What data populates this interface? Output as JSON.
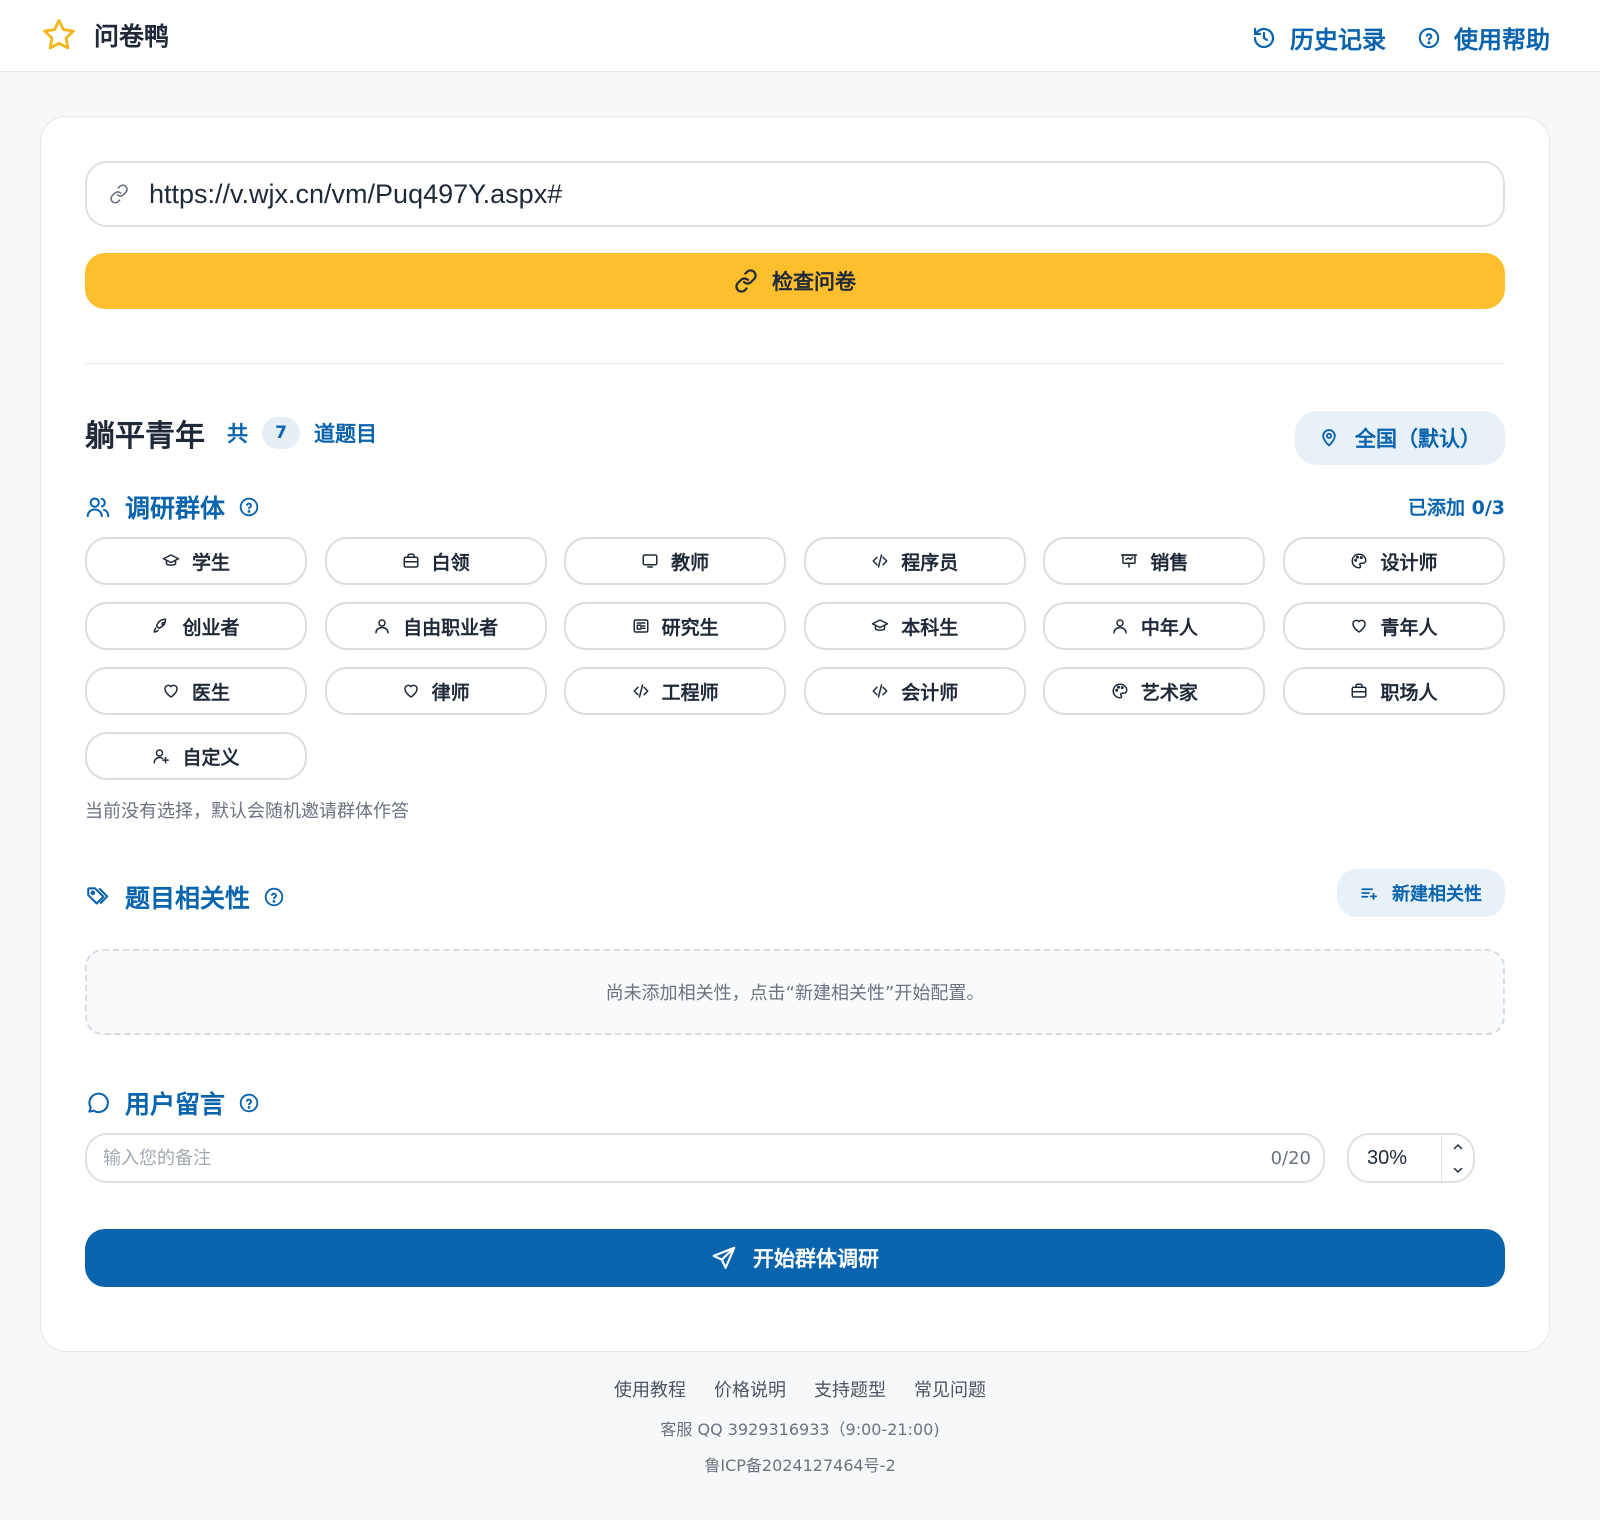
{
  "header": {
    "brand_name": "问卷鸭",
    "nav": [
      {
        "label": "历史记录",
        "icon": "history-icon"
      },
      {
        "label": "使用帮助",
        "icon": "help-circle-icon"
      }
    ]
  },
  "url_input": {
    "value": "https://v.wjx.cn/vm/Puq497Y.aspx#"
  },
  "check_button": {
    "label": "检查问卷"
  },
  "survey": {
    "title": "躺平青年",
    "count_prefix": "共",
    "question_count": "7",
    "count_suffix": "道题目",
    "region_button": "全国（默认）"
  },
  "groups_section": {
    "title": "调研群体",
    "added": "已添加 0/3",
    "chips": [
      {
        "label": "学生",
        "icon": "graduation-cap-icon"
      },
      {
        "label": "白领",
        "icon": "briefcase-icon"
      },
      {
        "label": "教师",
        "icon": "monitor-icon"
      },
      {
        "label": "程序员",
        "icon": "code-icon"
      },
      {
        "label": "销售",
        "icon": "presentation-icon"
      },
      {
        "label": "设计师",
        "icon": "palette-icon"
      },
      {
        "label": "创业者",
        "icon": "rocket-icon"
      },
      {
        "label": "自由职业者",
        "icon": "user-icon"
      },
      {
        "label": "研究生",
        "icon": "newspaper-icon"
      },
      {
        "label": "本科生",
        "icon": "graduation-cap-icon"
      },
      {
        "label": "中年人",
        "icon": "user-icon"
      },
      {
        "label": "青年人",
        "icon": "heart-icon"
      },
      {
        "label": "医生",
        "icon": "heart-icon"
      },
      {
        "label": "律师",
        "icon": "heart-icon"
      },
      {
        "label": "工程师",
        "icon": "code-icon"
      },
      {
        "label": "会计师",
        "icon": "code-icon"
      },
      {
        "label": "艺术家",
        "icon": "palette-icon"
      },
      {
        "label": "职场人",
        "icon": "briefcase-icon"
      },
      {
        "label": "自定义",
        "icon": "user-plus-icon"
      }
    ],
    "hint": "当前没有选择，默认会随机邀请群体作答"
  },
  "relevance_section": {
    "title": "题目相关性",
    "new_button": "新建相关性",
    "empty_text": "尚未添加相关性，点击“新建相关性”开始配置。"
  },
  "comment_section": {
    "title": "用户留言",
    "placeholder": "输入您的备注",
    "counter": "0/20",
    "percent": "30%"
  },
  "start_button": {
    "label": "开始群体调研"
  },
  "footer": {
    "links": [
      "使用教程",
      "价格说明",
      "支持题型",
      "常见问题"
    ],
    "support": "客服 QQ 3929316933（9:00-21:00)",
    "icp": "鲁ICP备2024127464号-2"
  },
  "colors": {
    "primary": "#0a64ad",
    "accent": "#fdbf2e",
    "brand_star": "#f5b71e"
  }
}
